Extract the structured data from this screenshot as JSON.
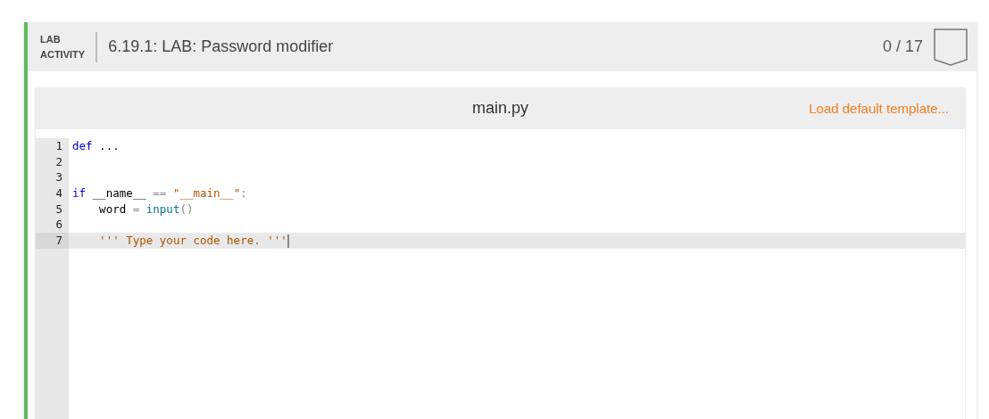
{
  "activity": {
    "label_top": "LAB",
    "label_bottom": "ACTIVITY",
    "title": "6.19.1: LAB: Password modifier",
    "score": "0 / 17"
  },
  "editor": {
    "filename": "main.py",
    "template_link": "Load default template...",
    "lines": [
      {
        "number": "1",
        "active": false,
        "tokens": [
          {
            "kind": "keyword",
            "text": "def"
          },
          {
            "kind": "plain",
            "text": " ..."
          }
        ]
      },
      {
        "number": "2",
        "active": false
      },
      {
        "number": "3",
        "active": false
      },
      {
        "number": "4",
        "active": false,
        "tokens": [
          {
            "kind": "keyword",
            "text": "if"
          },
          {
            "kind": "plain",
            "text": " __name__ "
          },
          {
            "kind": "operator",
            "text": "=="
          },
          {
            "kind": "string",
            "text": " \"__main__\""
          },
          {
            "kind": "operator",
            "text": ":"
          }
        ]
      },
      {
        "number": "5",
        "active": false,
        "tokens": [
          {
            "kind": "plain",
            "text": "    word "
          },
          {
            "kind": "operator",
            "text": "="
          },
          {
            "kind": "builtin",
            "text": " input"
          },
          {
            "kind": "operator",
            "text": "()"
          }
        ]
      },
      {
        "number": "6",
        "active": false
      },
      {
        "number": "7",
        "active": true,
        "tokens": [
          {
            "kind": "string",
            "text": "    ''' Type your code here. '''"
          }
        ]
      }
    ]
  }
}
